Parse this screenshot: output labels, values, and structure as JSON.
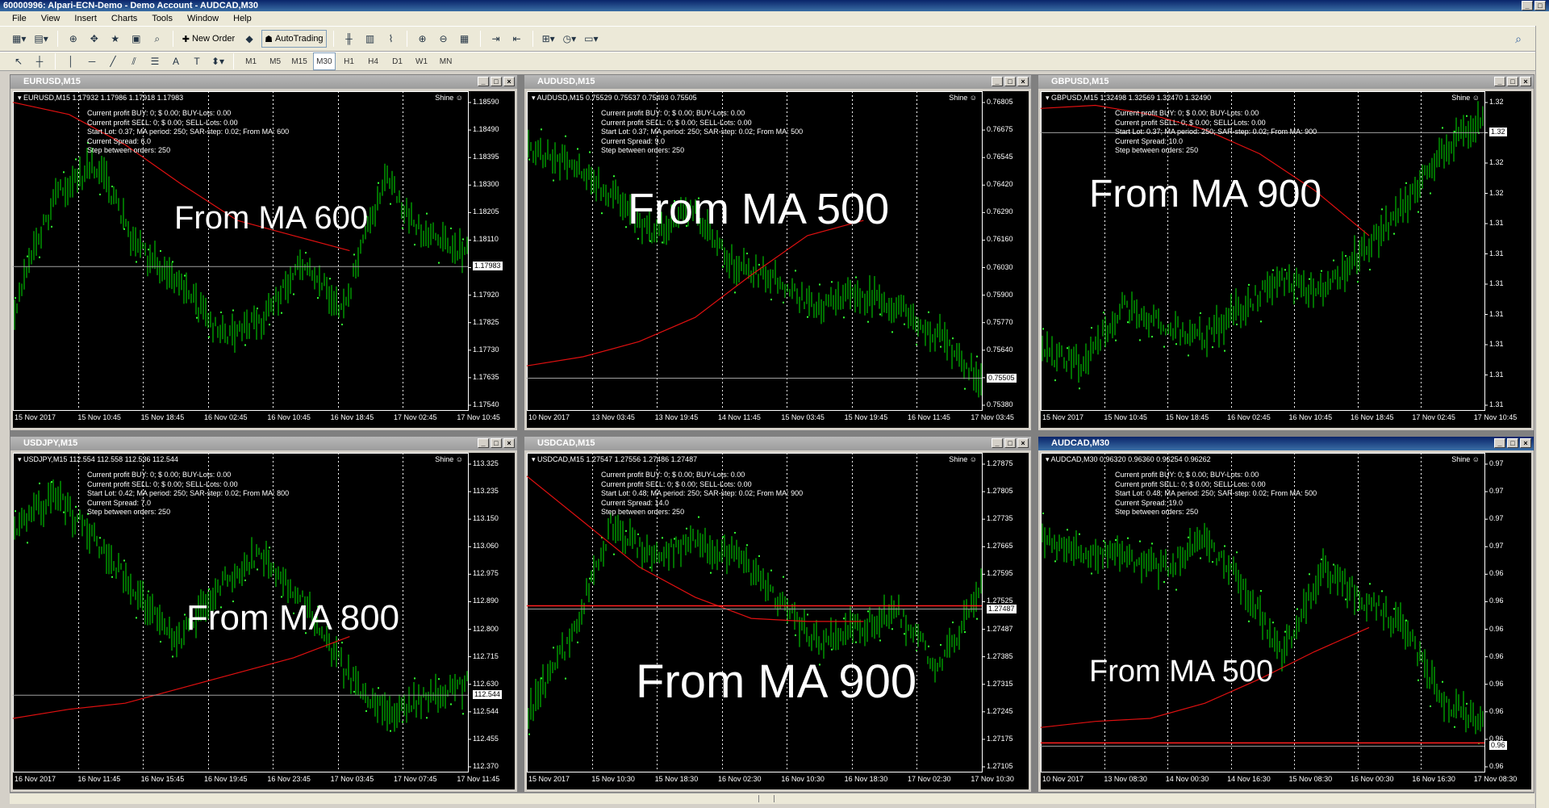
{
  "window": {
    "title": "60000996: Alpari-ECN-Demo - Demo Account - AUDCAD,M30"
  },
  "menu": [
    "File",
    "View",
    "Insert",
    "Charts",
    "Tools",
    "Window",
    "Help"
  ],
  "toolbar": {
    "new_order": "New Order",
    "autotrading": "AutoTrading"
  },
  "timeframes": [
    "M1",
    "M5",
    "M15",
    "M30",
    "H1",
    "H4",
    "D1",
    "W1",
    "MN"
  ],
  "active_timeframe": "M30",
  "colors": {
    "chart_bg": "#000000",
    "bars": "#00e000",
    "ma": "#e01010",
    "sar": "#33ff33",
    "text": "#ffffff"
  },
  "charts": [
    {
      "caption": "EURUSD,M15",
      "instrument": "EURUSD,M15  1.17932 1.17986 1.17918 1.17983",
      "shine": "Shine",
      "info": [
        "Current profit BUY: 0; $ 0.00; BUY-Lots: 0.00",
        "Current profit SELL: 0; $ 0.00; SELL-Lots: 0.00",
        "Start Lot: 0.37;   MA period: 250; SAR-step: 0.02; From MA: 600",
        "Current Spread: 6.0",
        "Step between orders: 250"
      ],
      "overlay": "From MA 600",
      "prices": [
        "1.18590",
        "1.18490",
        "1.18395",
        "1.18300",
        "1.18205",
        "1.18110",
        "1.18015",
        "1.17920",
        "1.17825",
        "1.17730",
        "1.17635",
        "1.17540"
      ],
      "current_price": "1.17983",
      "times": [
        "15 Nov 2017",
        "15 Nov 10:45",
        "15 Nov 18:45",
        "16 Nov 02:45",
        "16 Nov 10:45",
        "16 Nov 18:45",
        "17 Nov 02:45",
        "17 Nov 10:45"
      ]
    },
    {
      "caption": "AUDUSD,M15",
      "instrument": "AUDUSD,M15  0.75529 0.75537 0.75493 0.75505",
      "shine": "Shine",
      "info": [
        "Current profit BUY: 0; $ 0.00; BUY-Lots: 0.00",
        "Current profit SELL: 0; $ 0.00; SELL-Lots: 0.00",
        "Start Lot: 0.37;   MA period: 250; SAR-step: 0.02; From MA: 500",
        "Current Spread: 9.0",
        "Step between orders: 250"
      ],
      "overlay": "From MA 500",
      "prices": [
        "0.76805",
        "0.76675",
        "0.76545",
        "0.76420",
        "0.76290",
        "0.76160",
        "0.76030",
        "0.75900",
        "0.75770",
        "0.75640",
        "0.75505",
        "0.75380"
      ],
      "current_price": "0.75505",
      "times": [
        "10 Nov 2017",
        "13 Nov 03:45",
        "13 Nov 19:45",
        "14 Nov 11:45",
        "15 Nov 03:45",
        "15 Nov 19:45",
        "16 Nov 11:45",
        "17 Nov 03:45"
      ]
    },
    {
      "caption": "GBPUSD,M15",
      "instrument": "GBPUSD,M15  1.32498 1.32569 1.32470 1.32490",
      "shine": "Shine",
      "info": [
        "Current profit BUY: 0; $ 0.00; BUY-Lots: 0.00",
        "Current profit SELL: 0; $ 0.00; SELL-Lots: 0.00",
        "Start Lot: 0.37;   MA period: 250; SAR-step: 0.02; From MA: 900",
        "Current Spread: 10.0",
        "Step between orders: 250"
      ],
      "overlay": "From MA 900",
      "prices": [
        "1.32",
        "1.32",
        "1.32",
        "1.32",
        "1.31",
        "1.31",
        "1.31",
        "1.31",
        "1.31",
        "1.31",
        "1.31"
      ],
      "current_price": "1.32",
      "times": [
        "15 Nov 2017",
        "15 Nov 10:45",
        "15 Nov 18:45",
        "16 Nov 02:45",
        "16 Nov 10:45",
        "16 Nov 18:45",
        "17 Nov 02:45",
        "17 Nov 10:45"
      ]
    },
    {
      "caption": "USDJPY,M15",
      "instrument": "USDJPY,M15  112.554 112.558 112.536 112.544",
      "shine": "Shine",
      "info": [
        "Current profit BUY: 0; $ 0.00; BUY-Lots: 0.00",
        "Current profit SELL: 0; $ 0.00; SELL-Lots: 0.00",
        "Start Lot: 0.42;   MA period: 250; SAR-step: 0.02; From MA: 800",
        "Current Spread: 7.0",
        "Step between orders: 250"
      ],
      "overlay": "From MA 800",
      "prices": [
        "113.325",
        "113.235",
        "113.150",
        "113.060",
        "112.975",
        "112.890",
        "112.800",
        "112.715",
        "112.630",
        "112.544",
        "112.455",
        "112.370"
      ],
      "current_price": "112.544",
      "times": [
        "16 Nov 2017",
        "16 Nov 11:45",
        "16 Nov 15:45",
        "16 Nov 19:45",
        "16 Nov 23:45",
        "17 Nov 03:45",
        "17 Nov 07:45",
        "17 Nov 11:45"
      ]
    },
    {
      "caption": "USDCAD,M15",
      "instrument": "USDCAD,M15  1.27547 1.27556 1.27486 1.27487",
      "shine": "Shine",
      "info": [
        "Current profit BUY: 0; $ 0.00; BUY-Lots: 0.00",
        "Current profit SELL: 0; $ 0.00; SELL-Lots: 0.00",
        "Start Lot: 0.48;   MA period: 250; SAR-step: 0.02; From MA: 900",
        "Current Spread: 14.0",
        "Step between orders: 250"
      ],
      "overlay": "From MA 900",
      "prices": [
        "1.27875",
        "1.27805",
        "1.27735",
        "1.27665",
        "1.27595",
        "1.27525",
        "1.27487",
        "1.27385",
        "1.27315",
        "1.27245",
        "1.27175",
        "1.27105"
      ],
      "current_price": "1.27487",
      "times": [
        "15 Nov 2017",
        "15 Nov 10:30",
        "15 Nov 18:30",
        "16 Nov 02:30",
        "16 Nov 10:30",
        "16 Nov 18:30",
        "17 Nov 02:30",
        "17 Nov 10:30"
      ]
    },
    {
      "caption": "AUDCAD,M30",
      "instrument": "AUDCAD,M30  0.96320 0.96360 0.96254 0.96262",
      "shine": "Shine",
      "info": [
        "Current profit BUY: 0; $ 0.00; BUY-Lots: 0.00",
        "Current profit SELL: 0; $ 0.00; SELL-Lots: 0.00",
        "Start Lot: 0.48;   MA period: 250; SAR-step: 0.02; From MA: 500",
        "Current Spread: 19.0",
        "Step between orders: 250"
      ],
      "overlay": "From MA 500",
      "prices": [
        "0.97",
        "0.97",
        "0.97",
        "0.97",
        "0.96",
        "0.96",
        "0.96",
        "0.96",
        "0.96",
        "0.96",
        "0.96",
        "0.96"
      ],
      "current_price": "0.96",
      "times": [
        "10 Nov 2017",
        "13 Nov 08:30",
        "14 Nov 00:30",
        "14 Nov 16:30",
        "15 Nov 08:30",
        "16 Nov 00:30",
        "16 Nov 16:30",
        "17 Nov 08:30"
      ]
    }
  ]
}
